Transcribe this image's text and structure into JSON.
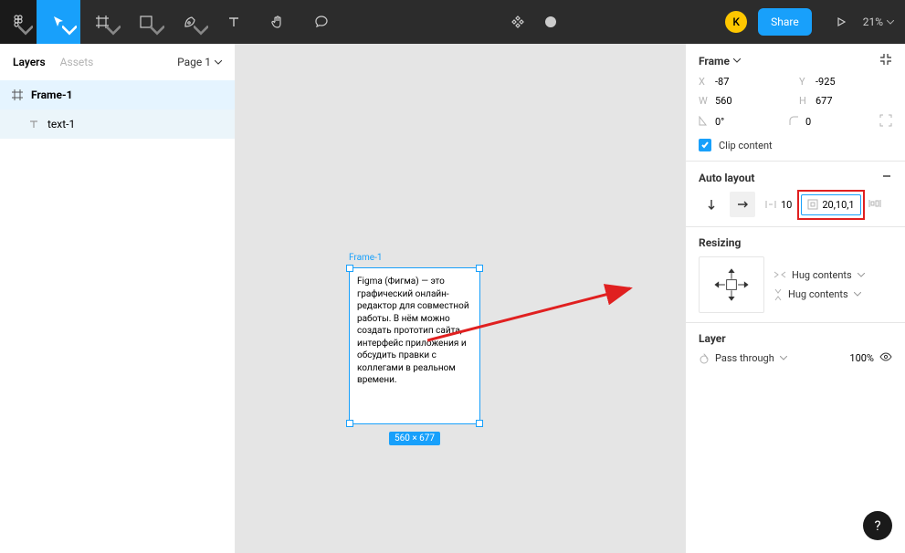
{
  "toolbar": {
    "avatar_initial": "K",
    "share_label": "Share",
    "zoom": "21%"
  },
  "left": {
    "tab_layers": "Layers",
    "tab_assets": "Assets",
    "page_label": "Page 1",
    "layers": [
      {
        "name": "Frame-1"
      },
      {
        "name": "text-1"
      }
    ]
  },
  "canvas": {
    "frame_label": "Frame-1",
    "frame_text": "Figma (Фигма) — это графический онлайн-редактор для совместной работы. В нём можно создать прототип сайта, интерфейс приложения и обсудить правки с коллегами в реальном времени.",
    "frame_dims": "560 × 677"
  },
  "right": {
    "frame_title": "Frame",
    "x_label": "X",
    "x_val": "-87",
    "y_label": "Y",
    "y_val": "-925",
    "w_label": "W",
    "w_val": "560",
    "h_label": "H",
    "h_val": "677",
    "rot_val": "0°",
    "rad_val": "0",
    "clip_label": "Clip content",
    "autolayout_title": "Auto layout",
    "spacing_val": "10",
    "padding_val": "20,10,1",
    "resizing_title": "Resizing",
    "hug_label": "Hug contents",
    "layer_title": "Layer",
    "blend_label": "Pass through",
    "opacity_val": "100%"
  },
  "help_label": "?"
}
